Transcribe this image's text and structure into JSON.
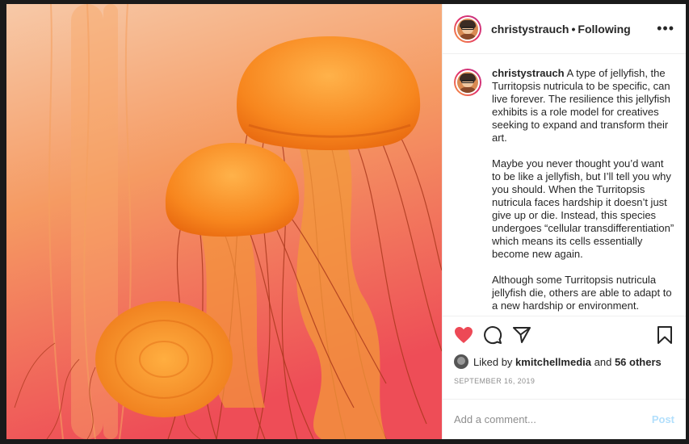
{
  "post": {
    "username": "christystrauch",
    "separator": "•",
    "follow_status": "Following",
    "more_label": "•••",
    "caption_username": "christystrauch",
    "caption_paragraphs": [
      "A type of jellyfish, the Turritopsis nutricula to be specific, can live forever. The resilience this jellyfish exhibits is a role model for creatives seeking to expand and transform their art.",
      "Maybe you never thought you’d want to be like a jellyfish, but I’ll tell you why you should. When the Turritopsis nutricula faces hardship it doesn’t just give up or die. Instead, this species undergoes “cellular transdifferentiation” which means its cells essentially become new again.",
      "Although some Turritopsis nutricula jellyfish die, others are able to adapt to a new hardship or environment."
    ],
    "liked_by_prefix": "Liked by",
    "liked_by_user": "kmitchellmedia",
    "liked_by_and": "and",
    "others_count": "56 others",
    "date": "SEPTEMBER 16, 2019"
  },
  "comment": {
    "placeholder": "Add a comment...",
    "post_label": "Post"
  },
  "icons": {
    "like": "heart-icon",
    "comment": "comment-icon",
    "share": "share-icon",
    "save": "bookmark-icon",
    "more": "more-options-icon"
  },
  "colors": {
    "like_red": "#ed4956",
    "post_disabled": "#b2dffc",
    "avatar_ring": "#e1306c"
  }
}
